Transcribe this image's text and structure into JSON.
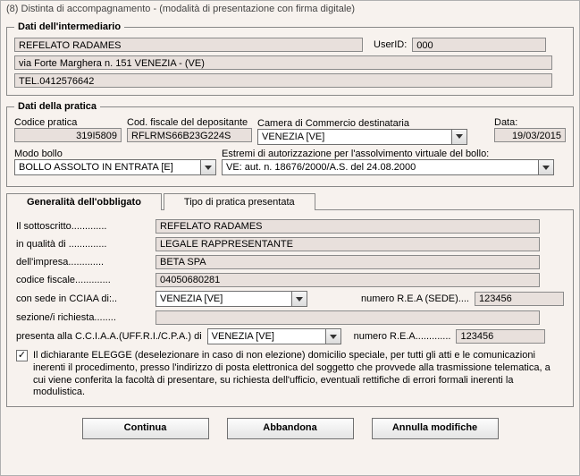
{
  "window": {
    "title": "(8) Distinta di accompagnamento - (modalità di presentazione con firma digitale)"
  },
  "intermediary": {
    "legend": "Dati dell'intermediario",
    "name": "REFELATO RADAMES",
    "userid_label": "UserID:",
    "userid_value": "000",
    "address": "via Forte Marghera n. 151 VENEZIA - (VE)",
    "phone": "TEL.0412576642"
  },
  "practice": {
    "legend": "Dati della pratica",
    "codice_pratica_label": "Codice pratica",
    "codice_pratica": "319I5809",
    "cod_fiscale_label": "Cod. fiscale del depositante",
    "cod_fiscale": "RFLRMS66B23G224S",
    "camera_label": "Camera di Commercio destinataria",
    "camera_value": "VENEZIA [VE]",
    "data_label": "Data:",
    "data_value": "19/03/2015",
    "modo_bollo_label": "Modo bollo",
    "modo_bollo_value": "BOLLO ASSOLTO IN ENTRATA [E]",
    "estremi_label": "Estremi di autorizzazione per l'assolvimento virtuale del bollo:",
    "estremi_value": "VE: aut. n. 18676/2000/A.S. del 24.08.2000"
  },
  "tabs": {
    "t1": "Generalità dell'obbligato",
    "t2": "Tipo di pratica presentata"
  },
  "obbligato": {
    "sottoscritto_label": "Il sottoscritto.............",
    "sottoscritto_value": "REFELATO RADAMES",
    "qualita_label": "in qualità di ..............",
    "qualita_value": "LEGALE RAPPRESENTANTE",
    "impresa_label": "dell'impresa.............",
    "impresa_value": "BETA SPA",
    "cf_label": "codice fiscale.............",
    "cf_value": "04050680281",
    "sede_label": "con sede in CCIAA di:..",
    "sede_value": "VENEZIA [VE]",
    "rea_sede_label": "numero R.E.A (SEDE)....",
    "rea_sede_value": "123456",
    "sezione_label": "sezione/i richiesta........",
    "sezione_value": "",
    "presenta_label": "presenta alla C.C.I.A.A.(UFF.R.I./C.P.A.) di",
    "presenta_value": "VENEZIA [VE]",
    "rea_label": "numero R.E.A.............",
    "rea_value": "123456",
    "declaration": "Il dichiarante ELEGGE (deselezionare in caso di non elezione) domicilio speciale, per tutti gli atti e le comunicazioni inerenti il procedimento, presso l'indirizzo di posta elettronica del soggetto che provvede alla trasmissione telematica, a cui viene conferita la facoltà di presentare, su richiesta dell'ufficio, eventuali rettifiche di errori formali inerenti la modulistica."
  },
  "buttons": {
    "continua": "Continua",
    "abbandona": "Abbandona",
    "annulla": "Annulla modifiche"
  }
}
